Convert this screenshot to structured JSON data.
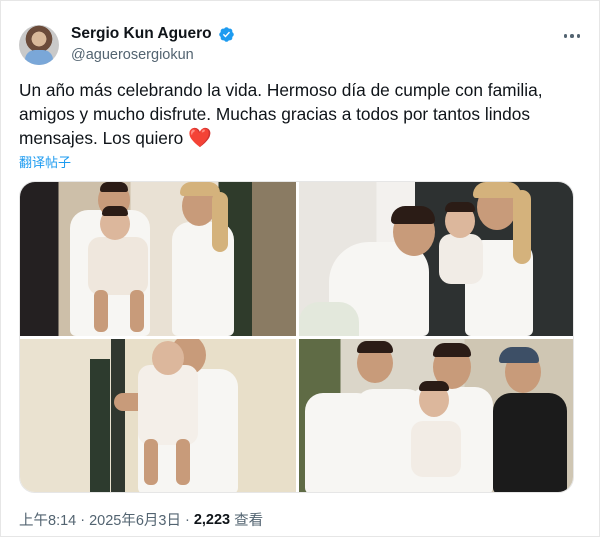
{
  "author": {
    "name": "Sergio Kun Aguero",
    "handle": "@aguerosergiokun",
    "verified": true
  },
  "post": {
    "text": "Un año más celebrando la vida. Hermoso día de cumple con familia, amigos y mucho disfrute. Muchas gracias a todos por tantos lindos mensajes. Los quiero",
    "emoji": "❤️",
    "translate_label": "翻译帖子"
  },
  "media": {
    "photo_count": 4
  },
  "meta": {
    "time": "上午8:14",
    "separator": "·",
    "date": "2025年6月3日",
    "views": "2,223",
    "views_label": "查看"
  },
  "icons": {
    "verified": "verified-badge-icon",
    "more": "more-horizontal-icon"
  },
  "colors": {
    "link": "#1d9bf0",
    "secondary_text": "#536471",
    "heart": "#e0245e"
  }
}
